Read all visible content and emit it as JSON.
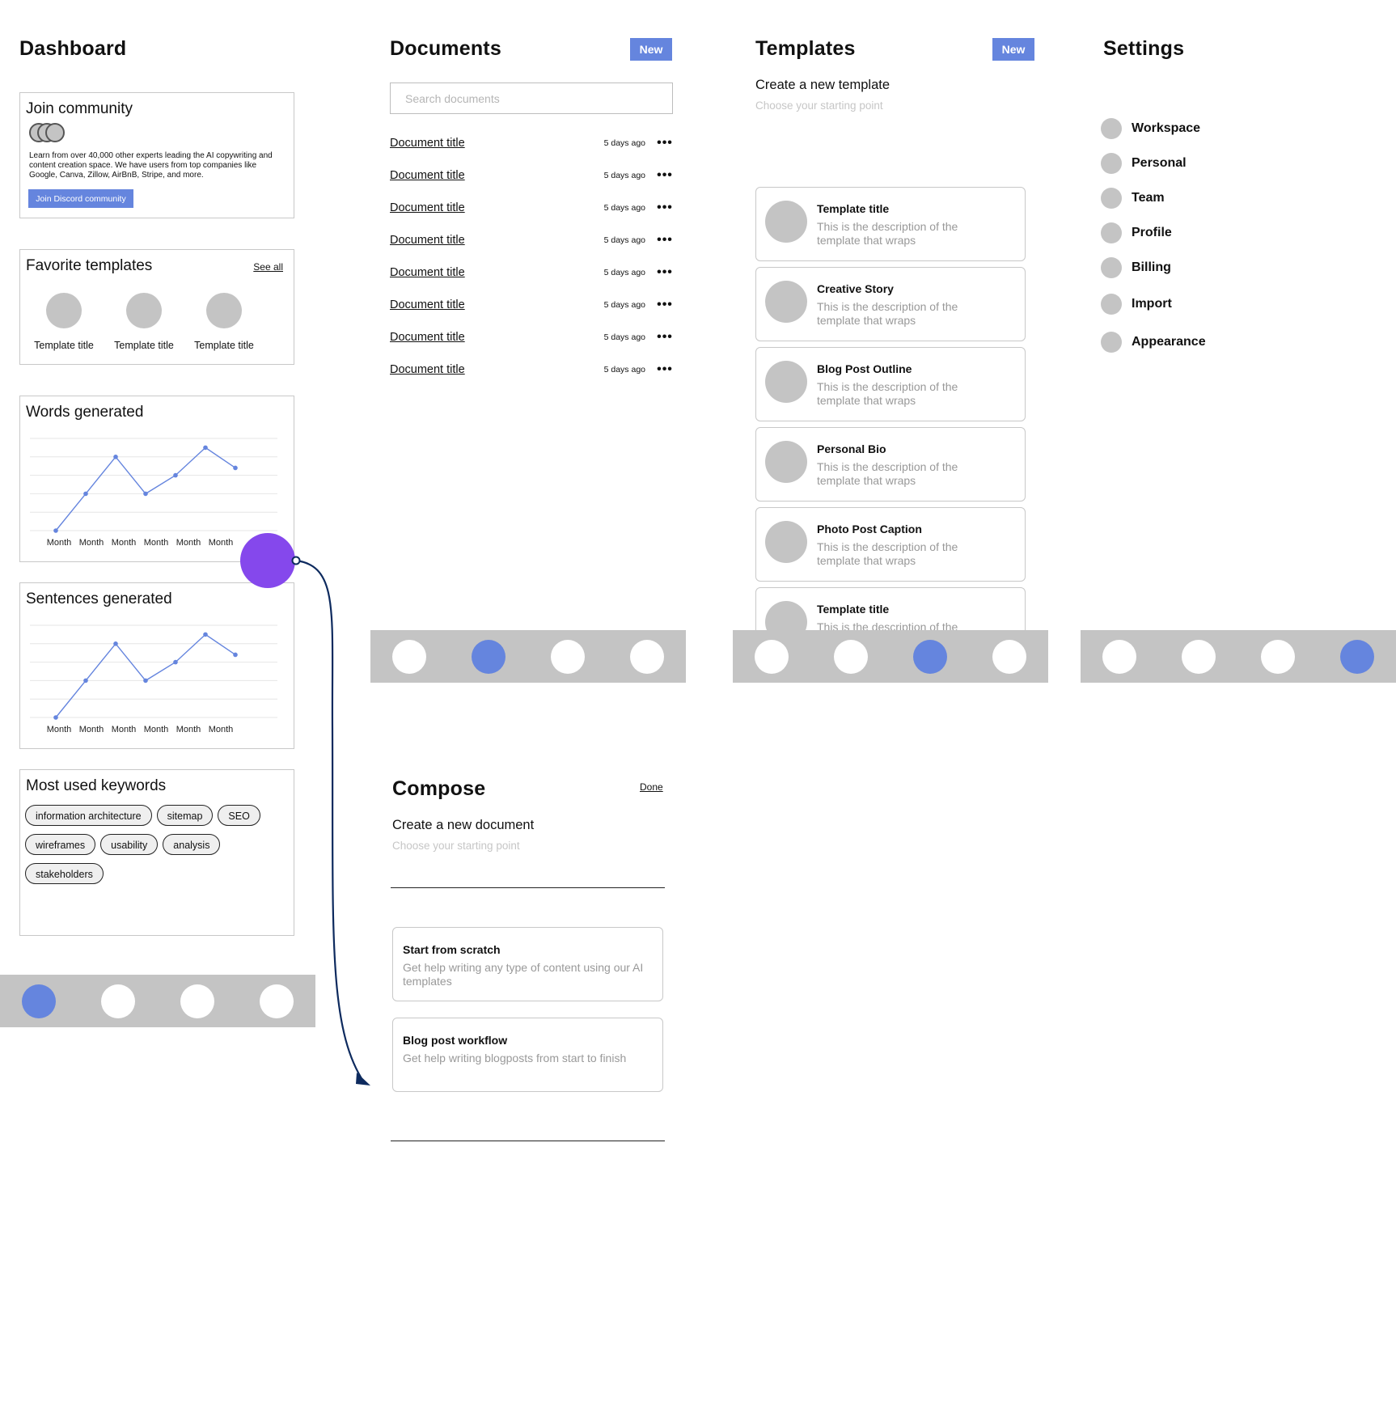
{
  "colors": {
    "accent": "#6585de",
    "hotspot": "#8548ec",
    "arrow": "#0d2a5e",
    "tabbar": "#c4c4c4"
  },
  "dashboard": {
    "title": "Dashboard",
    "community": {
      "title": "Join community",
      "text": "Learn from over 40,000 other experts leading the AI copywriting and content creation space. We have users from top companies like Google, Canva, Zillow, AirBnB, Stripe, and more.",
      "button": "Join Discord community"
    },
    "favorites": {
      "title": "Favorite templates",
      "see_all": "See all",
      "items": [
        "Template title",
        "Template title",
        "Template title"
      ]
    },
    "keywords": {
      "title": "Most used keywords",
      "items": [
        "information architecture",
        "sitemap",
        "SEO",
        "wireframes",
        "usability",
        "analysis",
        "stakeholders"
      ]
    },
    "tabs_active": 0
  },
  "chart_data": [
    {
      "type": "line",
      "title": "Words generated",
      "categories": [
        "Month",
        "Month",
        "Month",
        "Month",
        "Month",
        "Month"
      ],
      "values": [
        0,
        2,
        4,
        2,
        3,
        4.5,
        3.4
      ],
      "ylim": [
        0,
        5
      ],
      "grid": true
    },
    {
      "type": "line",
      "title": "Sentences generated",
      "categories": [
        "Month",
        "Month",
        "Month",
        "Month",
        "Month",
        "Month"
      ],
      "values": [
        0,
        2,
        4,
        2,
        3,
        4.5,
        3.4
      ],
      "ylim": [
        0,
        5
      ],
      "grid": true
    }
  ],
  "documents": {
    "title": "Documents",
    "new_label": "New",
    "search_placeholder": "Search documents",
    "items": [
      {
        "title": "Document title",
        "date": "5 days ago"
      },
      {
        "title": "Document title",
        "date": "5 days ago"
      },
      {
        "title": "Document title",
        "date": "5 days ago"
      },
      {
        "title": "Document title",
        "date": "5 days ago"
      },
      {
        "title": "Document title",
        "date": "5 days ago"
      },
      {
        "title": "Document title",
        "date": "5 days ago"
      },
      {
        "title": "Document title",
        "date": "5 days ago"
      },
      {
        "title": "Document title",
        "date": "5 days ago"
      }
    ],
    "more_glyph": "•••",
    "tabs_active": 1
  },
  "templates": {
    "title": "Templates",
    "new_label": "New",
    "subtitle": "Create a new template",
    "hint": "Choose your starting point",
    "items": [
      {
        "title": "Template title",
        "desc": "This is the description of the template that wraps"
      },
      {
        "title": "Creative Story",
        "desc": "This is the description of the template that wraps"
      },
      {
        "title": "Blog Post Outline",
        "desc": "This is the description of the template that wraps"
      },
      {
        "title": "Personal Bio",
        "desc": "This is the description of the template that wraps"
      },
      {
        "title": "Photo Post Caption",
        "desc": "This is the description of the template that wraps"
      },
      {
        "title": "Template title",
        "desc": "This is the description of the"
      }
    ],
    "tabs_active": 2
  },
  "settings": {
    "title": "Settings",
    "items": [
      "Workspace",
      "Personal",
      "Team",
      "Profile",
      "Billing",
      "Import",
      "Appearance"
    ],
    "tabs_active": 3
  },
  "compose": {
    "title": "Compose",
    "done": "Done",
    "subtitle": "Create a new document",
    "hint": "Choose your starting point",
    "options": [
      {
        "title": "Start from scratch",
        "desc": "Get help writing any type of content using our AI templates"
      },
      {
        "title": "Blog post workflow",
        "desc": "Get help writing blogposts from start to finish"
      }
    ]
  }
}
